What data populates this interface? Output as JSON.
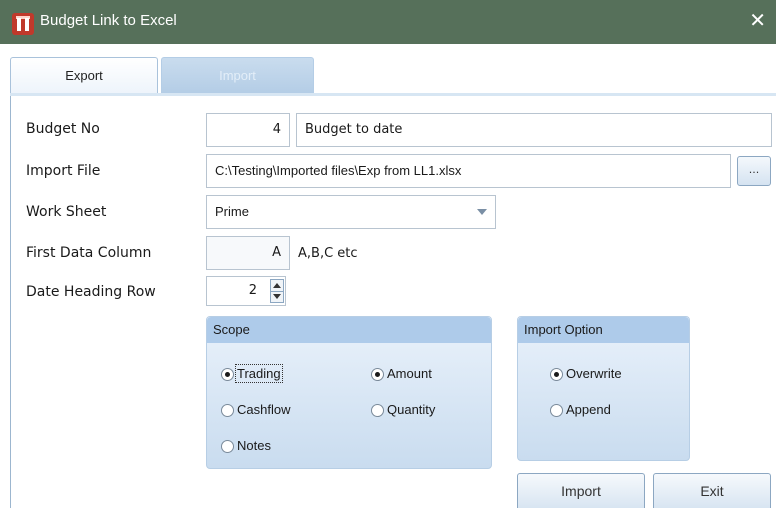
{
  "window": {
    "title": "Budget Link to Excel",
    "close_glyph": "✕",
    "titlebar_color": "#56705a",
    "app_icon": "app-logo-icon"
  },
  "tabs": [
    {
      "label": "Export",
      "active": true
    },
    {
      "label": "Import",
      "active": false
    }
  ],
  "form": {
    "budget_no": {
      "label": "Budget No",
      "value": "4",
      "name": "Budget to date"
    },
    "import_file": {
      "label": "Import File",
      "value": "C:\\Testing\\Imported files\\Exp from LL1.xlsx",
      "browse_label": "..."
    },
    "work_sheet": {
      "label": "Work Sheet",
      "value": "Prime"
    },
    "first_data_column": {
      "label": "First Data Column",
      "value": "A",
      "hint": "A,B,C etc"
    },
    "date_heading_row": {
      "label": "Date Heading Row",
      "value": "2"
    }
  },
  "scope": {
    "title": "Scope",
    "options": [
      {
        "label": "Trading",
        "checked": true
      },
      {
        "label": "Cashflow",
        "checked": false
      },
      {
        "label": "Notes",
        "checked": false
      },
      {
        "label": "Amount",
        "checked": true
      },
      {
        "label": "Quantity",
        "checked": false
      }
    ]
  },
  "import_option": {
    "title": "Import Option",
    "options": [
      {
        "label": "Overwrite",
        "checked": true
      },
      {
        "label": "Append",
        "checked": false
      }
    ]
  },
  "buttons": {
    "import": "Import",
    "exit": "Exit"
  }
}
